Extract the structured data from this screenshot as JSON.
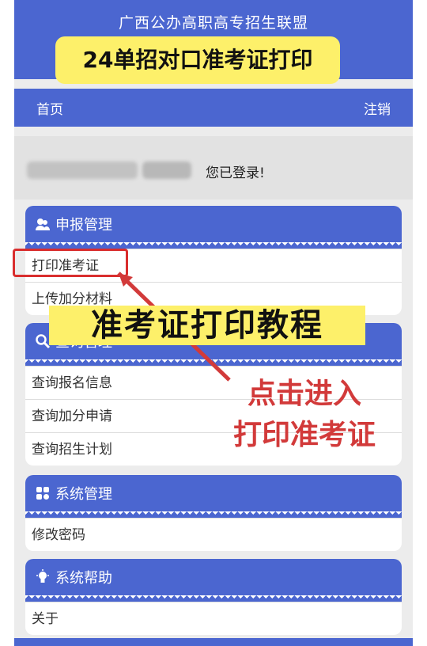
{
  "header": {
    "site_title": "广西公办高职高专招生联盟"
  },
  "banner": {
    "text": "24单招对口准考证打印"
  },
  "nav": {
    "home": "首页",
    "logout": "注销"
  },
  "login": {
    "message": "您已登录!"
  },
  "panels": [
    {
      "title": "申报管理",
      "icon": "user-icon",
      "items": [
        "打印准考证",
        "上传加分材料"
      ]
    },
    {
      "title": "查询管理",
      "icon": "search-icon",
      "items": [
        "查询报名信息",
        "查询加分申请",
        "查询招生计划"
      ]
    },
    {
      "title": "系统管理",
      "icon": "grid-icon",
      "items": [
        "修改密码"
      ]
    },
    {
      "title": "系统帮助",
      "icon": "lightbulb-icon",
      "items": [
        "关于"
      ]
    }
  ],
  "overlay": {
    "title": "准考证打印教程",
    "annotation_line1": "点击进入",
    "annotation_line2": "打印准考证"
  },
  "colors": {
    "primary": "#4b66d0",
    "highlight": "#fdf06a",
    "annotation": "#d23a3a"
  }
}
